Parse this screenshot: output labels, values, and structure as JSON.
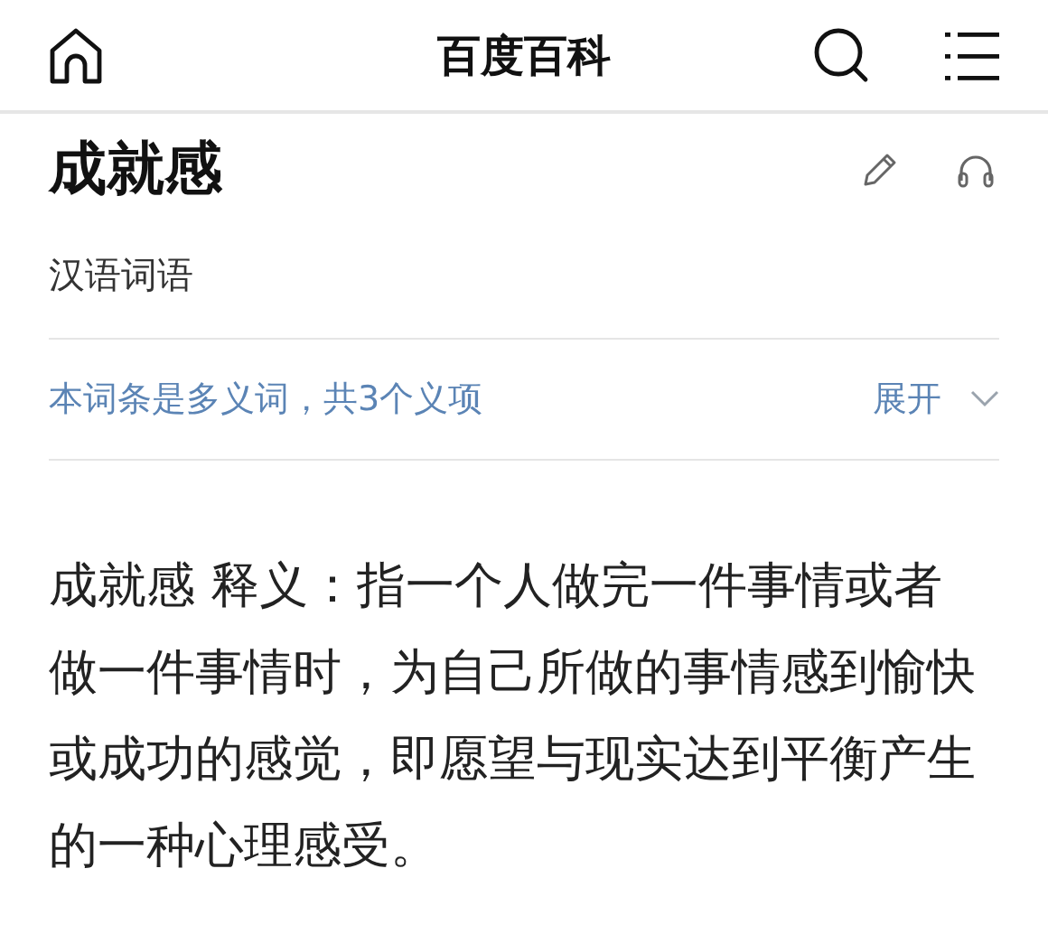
{
  "header": {
    "title": "百度百科"
  },
  "entry": {
    "title": "成就感",
    "subtitle": "汉语词语"
  },
  "polysemy": {
    "note": "本词条是多义词，共3个义项",
    "toggle": "展开",
    "expanded": false
  },
  "definition": "成就感 释义：指一个人做完一件事情或者做一件事情时，为自己所做的事情感到愉快或成功的感觉，即愿望与现实达到平衡产生的一种心理感受。"
}
